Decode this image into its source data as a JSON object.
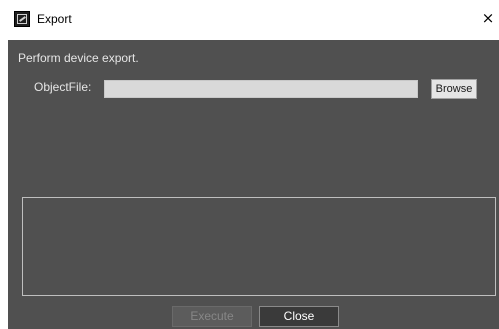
{
  "window": {
    "title": "Export",
    "close_glyph": "×"
  },
  "form": {
    "description": "Perform device export.",
    "object_file_label": "ObjectFile:",
    "object_file_value": "",
    "browse_label": "Browse"
  },
  "log": {
    "text": ""
  },
  "footer": {
    "execute_label": "Execute",
    "execute_enabled": false,
    "close_label": "Close"
  },
  "colors": {
    "client_background": "#505050",
    "input_background": "#d9d9d9",
    "disabled_text": "#878787"
  },
  "icons": {
    "app": "export-app-icon",
    "close": "close-icon"
  }
}
